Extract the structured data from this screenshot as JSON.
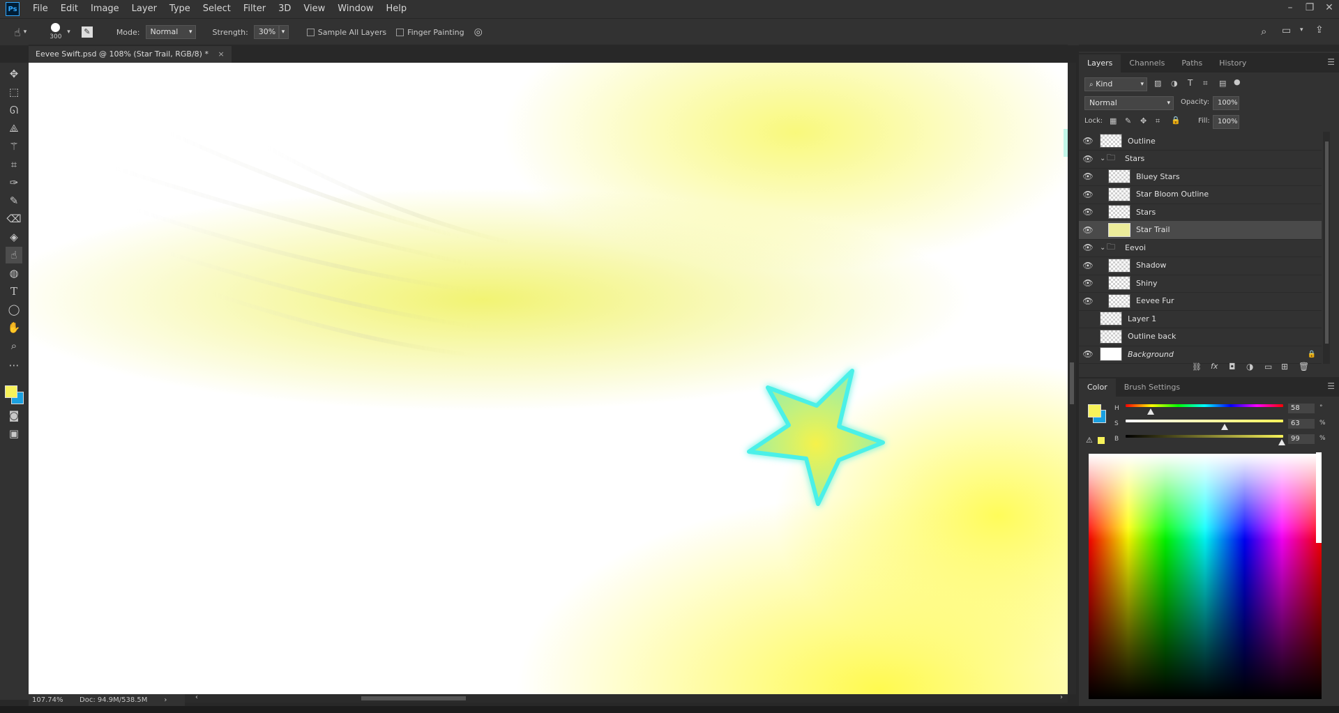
{
  "app": {
    "logo": "Ps"
  },
  "menu": [
    "File",
    "Edit",
    "Image",
    "Layer",
    "Type",
    "Select",
    "Filter",
    "3D",
    "View",
    "Window",
    "Help"
  ],
  "window_controls": {
    "minimize": "–",
    "restore": "❐",
    "close": "✕"
  },
  "options": {
    "brush_size": "300",
    "mode_label": "Mode:",
    "mode_value": "Normal",
    "strength_label": "Strength:",
    "strength_value": "30%",
    "sample_all_layers": "Sample All Layers",
    "finger_painting": "Finger Painting"
  },
  "document_tab": {
    "title": "Eevee Swift.psd @ 108% (Star Trail, RGB/8) *",
    "close": "×"
  },
  "status": {
    "zoom": "107.74%",
    "doc": "Doc: 94.9M/538.5M"
  },
  "layers_panel": {
    "tabs": [
      "Layers",
      "Channels",
      "Paths",
      "History"
    ],
    "kind_filter": "Kind",
    "blend_mode": "Normal",
    "opacity_label": "Opacity:",
    "opacity_value": "100%",
    "lock_label": "Lock:",
    "fill_label": "Fill:",
    "fill_value": "100%",
    "layers": [
      {
        "name": "Outline",
        "visible": true,
        "indent": 0,
        "type": "layer"
      },
      {
        "name": "Stars",
        "visible": true,
        "indent": 0,
        "type": "group"
      },
      {
        "name": "Bluey Stars",
        "visible": true,
        "indent": 1,
        "type": "layer"
      },
      {
        "name": "Star Bloom Outline",
        "visible": true,
        "indent": 1,
        "type": "layer"
      },
      {
        "name": "Stars",
        "visible": true,
        "indent": 1,
        "type": "layer"
      },
      {
        "name": "Star Trail",
        "visible": true,
        "indent": 1,
        "type": "layer",
        "selected": true
      },
      {
        "name": "Eevoi",
        "visible": true,
        "indent": 0,
        "type": "group"
      },
      {
        "name": "Shadow",
        "visible": true,
        "indent": 1,
        "type": "layer"
      },
      {
        "name": "Shiny",
        "visible": true,
        "indent": 1,
        "type": "layer"
      },
      {
        "name": "Eevee Fur",
        "visible": true,
        "indent": 1,
        "type": "layer"
      },
      {
        "name": "Layer 1",
        "visible": false,
        "indent": 0,
        "type": "layer"
      },
      {
        "name": "Outline back",
        "visible": false,
        "indent": 0,
        "type": "layer"
      },
      {
        "name": "Background",
        "visible": true,
        "indent": 0,
        "type": "background",
        "locked": true
      }
    ]
  },
  "color_panel": {
    "tabs": [
      "Color",
      "Brush Settings"
    ],
    "h_label": "H",
    "h_value": "58",
    "h_unit": "°",
    "s_label": "S",
    "s_value": "63",
    "s_unit": "%",
    "b_label": "B",
    "b_value": "99",
    "b_unit": "%",
    "foreground_color": "#f7f25a",
    "background_color": "#1aa0e0",
    "h_fraction": 0.16,
    "s_fraction": 0.63,
    "b_fraction": 0.99
  }
}
